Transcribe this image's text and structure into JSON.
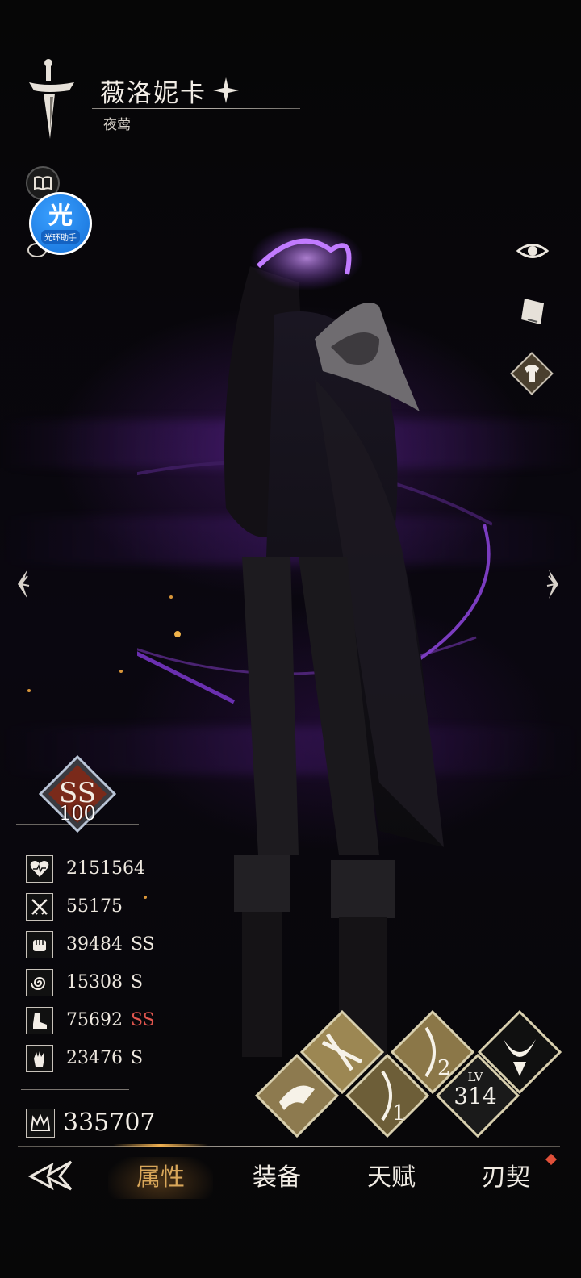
{
  "character": {
    "name": "薇洛妮卡",
    "class_name": "夜莺"
  },
  "assistant_badge": {
    "main_char": "光",
    "sub_label": "光环助手"
  },
  "rank": {
    "grade": "SS",
    "level": "100"
  },
  "stats": [
    {
      "icon": "heart-icon",
      "value": "2151564",
      "grade": ""
    },
    {
      "icon": "crossed-swords-icon",
      "value": "55175",
      "grade": ""
    },
    {
      "icon": "fist-icon",
      "value": "39484",
      "grade": "SS"
    },
    {
      "icon": "spiral-icon",
      "value": "15308",
      "grade": "S"
    },
    {
      "icon": "boot-icon",
      "value": "75692",
      "grade": "SS"
    },
    {
      "icon": "hand-icon",
      "value": "23476",
      "grade": "S"
    }
  ],
  "power": {
    "icon": "crown-icon",
    "value": "335707"
  },
  "skills": {
    "lv_label": "LV",
    "lv_value": "314",
    "slot_2_number": "2",
    "slot_1_number": "1"
  },
  "nav": {
    "tabs": [
      "属性",
      "装备",
      "天赋",
      "刃契"
    ],
    "active_index": 0
  },
  "colors": {
    "accent_gold": "#d9a75a",
    "grade_red": "#e0554e",
    "purple_glow": "#8a3fd1"
  }
}
